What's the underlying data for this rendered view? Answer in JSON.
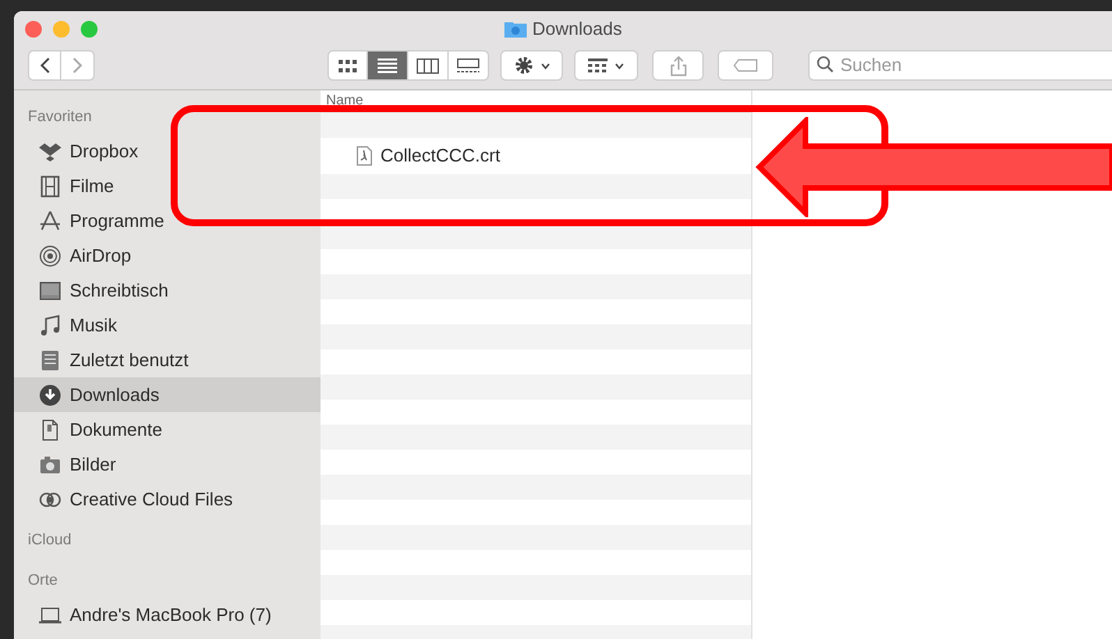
{
  "window": {
    "title": "Downloads"
  },
  "toolbar": {
    "view_modes": [
      {
        "kind": "icons",
        "selected": false
      },
      {
        "kind": "list",
        "selected": true
      },
      {
        "kind": "columns",
        "selected": false
      },
      {
        "kind": "gallery",
        "selected": false
      }
    ],
    "search": {
      "placeholder": "Suchen"
    }
  },
  "sidebar": {
    "sections": [
      {
        "title": "Favoriten",
        "items": [
          {
            "label": "Dropbox",
            "selected": false
          },
          {
            "label": "Filme",
            "selected": false
          },
          {
            "label": "Programme",
            "selected": false
          },
          {
            "label": "AirDrop",
            "selected": false
          },
          {
            "label": "Schreibtisch",
            "selected": false
          },
          {
            "label": "Musik",
            "selected": false
          },
          {
            "label": "Zuletzt benutzt",
            "selected": false
          },
          {
            "label": "Downloads",
            "selected": true
          },
          {
            "label": "Dokumente",
            "selected": false
          },
          {
            "label": "Bilder",
            "selected": false
          },
          {
            "label": "Creative Cloud Files",
            "selected": false
          }
        ]
      },
      {
        "title": "iCloud"
      },
      {
        "title": "Orte",
        "items": [
          {
            "label": "Andre's MacBook Pro (7)",
            "selected": false
          }
        ]
      }
    ]
  },
  "file_list": {
    "columns": [
      "Name"
    ],
    "rows": [
      {
        "name": "CollectCCC.crt",
        "selected": false
      }
    ]
  }
}
